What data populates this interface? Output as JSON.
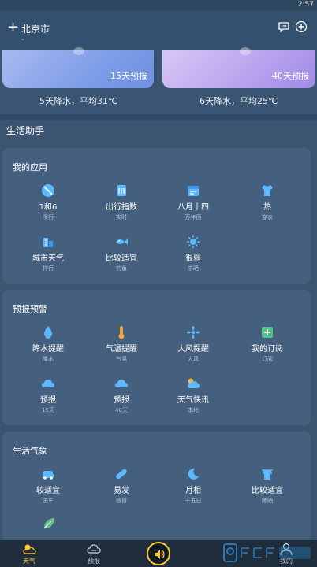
{
  "status": {
    "time": "2:57"
  },
  "header": {
    "plus": "+",
    "city": "北京市",
    "sub": "-"
  },
  "forecast": {
    "left": {
      "label": "15天预报",
      "summary": "5天降水，平均31℃"
    },
    "right": {
      "label": "40天预报",
      "summary": "6天降水，平均25℃"
    }
  },
  "assistant": {
    "title": "生活助手"
  },
  "my_apps": {
    "title": "我的应用",
    "items": [
      {
        "label": "1和6",
        "sub": "限行",
        "icon": "no-drive-icon"
      },
      {
        "label": "出行指数",
        "sub": "实时",
        "icon": "travel-index-icon"
      },
      {
        "label": "八月十四",
        "sub": "万年历",
        "icon": "calendar-icon"
      },
      {
        "label": "热",
        "sub": "穿衣",
        "icon": "clothing-icon"
      },
      {
        "label": "城市天气",
        "sub": "排行",
        "icon": "city-weather-icon"
      },
      {
        "label": "比较适宜",
        "sub": "钓鱼",
        "icon": "fish-icon"
      },
      {
        "label": "很弱",
        "sub": "防晒",
        "icon": "sun-icon"
      }
    ]
  },
  "alerts": {
    "title": "预报预警",
    "items": [
      {
        "label": "降水提醒",
        "sub": "降水",
        "icon": "raindrop-icon"
      },
      {
        "label": "气温提醒",
        "sub": "气温",
        "icon": "thermometer-icon"
      },
      {
        "label": "大风提醒",
        "sub": "大风",
        "icon": "wind-icon"
      },
      {
        "label": "我的订阅",
        "sub": "订阅",
        "icon": "subscribe-icon"
      },
      {
        "label": "预报",
        "sub": "15天",
        "icon": "cloud-15-icon"
      },
      {
        "label": "预报",
        "sub": "40天",
        "icon": "cloud-40-icon"
      },
      {
        "label": "天气快讯",
        "sub": "本地",
        "icon": "weather-news-icon"
      }
    ]
  },
  "life": {
    "title": "生活气象",
    "items": [
      {
        "label": "较适宜",
        "sub": "洗车",
        "icon": "car-icon"
      },
      {
        "label": "易发",
        "sub": "感冒",
        "icon": "pill-icon"
      },
      {
        "label": "月相",
        "sub": "十五日",
        "icon": "moon-icon"
      },
      {
        "label": "比较适宜",
        "sub": "晾晒",
        "icon": "drying-icon"
      }
    ]
  },
  "nav": {
    "items": [
      {
        "label": "天气",
        "icon": "weather-icon"
      },
      {
        "label": "预报",
        "icon": "forecast-icon"
      },
      {
        "label": "我的",
        "icon": "profile-icon"
      }
    ]
  },
  "colors": {
    "accent": "#ffcc33",
    "icon_blue": "#5db8ff",
    "background": "#3c5470"
  }
}
